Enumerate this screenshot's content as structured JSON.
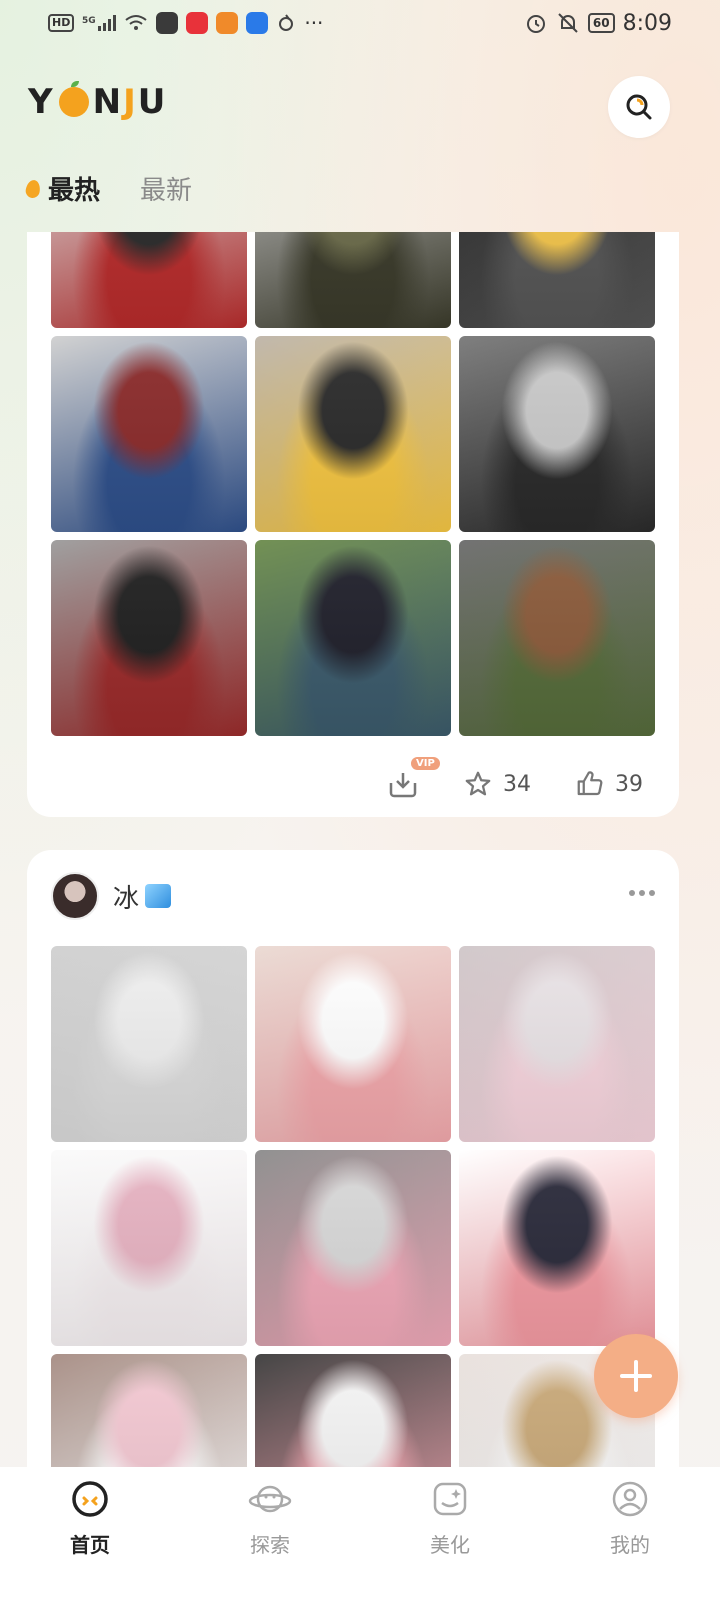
{
  "status_bar": {
    "left_badges": [
      "HD",
      "5G"
    ],
    "time": "8:09",
    "battery": "60",
    "icons": [
      "signal-icon",
      "wifi-icon",
      "app-tile-icons",
      "more-dots-icon",
      "alarm-icon",
      "mute-icon",
      "battery-icon"
    ]
  },
  "header": {
    "logo": {
      "y": "Y",
      "o": "",
      "n": "N",
      "j": "J",
      "u": "U"
    },
    "search_icon": "search-icon"
  },
  "tabs": [
    {
      "label": "最热",
      "active": true
    },
    {
      "label": "最新",
      "active": false
    }
  ],
  "card_1": {
    "photos": [
      {
        "name": "photo-red-scarf-woman",
        "colors": [
          "#b62b2b",
          "#2a2a2a",
          "#dadada"
        ]
      },
      {
        "name": "photo-backpack-long-hair",
        "colors": [
          "#3a3a2a",
          "#6b6b4a",
          "#bbb"
        ]
      },
      {
        "name": "photo-street-knee-socks",
        "colors": [
          "#555",
          "#f2c44b",
          "#222"
        ]
      },
      {
        "name": "photo-plaid-scarf-snow",
        "colors": [
          "#2e4f8a",
          "#8a2a2a",
          "#cfcfcf"
        ]
      },
      {
        "name": "photo-maple-leaf-girl",
        "colors": [
          "#f4c542",
          "#2a2a2a",
          "#bdb4a8"
        ]
      },
      {
        "name": "photo-hood-snow",
        "colors": [
          "#2a2a2a",
          "#c9c9c9",
          "#777"
        ]
      },
      {
        "name": "photo-peace-sign-selfie",
        "colors": [
          "#9a2a2a",
          "#1f1f1f",
          "#9a9a9a"
        ]
      },
      {
        "name": "photo-school-uniform-lake",
        "colors": [
          "#3b5a6b",
          "#1f1f2a",
          "#6a8a4a"
        ]
      },
      {
        "name": "photo-green-jacket-crouch",
        "colors": [
          "#556b3a",
          "#8a5a3a",
          "#6a6a6a"
        ]
      }
    ],
    "download_vip_label": "VIP",
    "star_count": "34",
    "like_count": "39"
  },
  "card_2": {
    "author": {
      "name": "冰",
      "emoji_icon": "ice-cube-icon"
    },
    "photos": [
      {
        "name": "photo-bubbles",
        "colors": [
          "#dcdcdc",
          "#efefef",
          "#cfcfcf"
        ]
      },
      {
        "name": "photo-pink-rose-bouquet-1",
        "colors": [
          "#f1a7ab",
          "#ffffff",
          "#ead9d2"
        ]
      },
      {
        "name": "photo-pink-plush-toy",
        "colors": [
          "#f6d4dd",
          "#e9e3e6",
          "#cfc6c8"
        ]
      },
      {
        "name": "photo-white-puppy-roses",
        "colors": [
          "#f4eef0",
          "#e7b3c2",
          "#fafafa"
        ]
      },
      {
        "name": "photo-balloon-rose-bouquet",
        "colors": [
          "#f0a8b8",
          "#d8d8d8",
          "#8a8a8a"
        ]
      },
      {
        "name": "photo-rose-bouquet-night",
        "colors": [
          "#f29aa2",
          "#2a2a3a",
          "#ffffff"
        ]
      },
      {
        "name": "photo-white-bouquet-bag",
        "colors": [
          "#ffffff",
          "#f3c8d2",
          "#a58b82"
        ]
      },
      {
        "name": "photo-pink-rose-bouquet-2",
        "colors": [
          "#f0a6b0",
          "#f4f4f4",
          "#3a3a3a"
        ]
      },
      {
        "name": "photo-ros-gift-box",
        "colors": [
          "#fafafa",
          "#c9a979",
          "#e8e0dc"
        ]
      }
    ]
  },
  "fab": {
    "icon": "plus-icon"
  },
  "bottom_nav": [
    {
      "label": "首页",
      "icon": "home-face-icon",
      "active": true
    },
    {
      "label": "探索",
      "icon": "planet-icon",
      "active": false
    },
    {
      "label": "美化",
      "icon": "sticker-icon",
      "active": false
    },
    {
      "label": "我的",
      "icon": "profile-icon",
      "active": false
    }
  ],
  "colors": {
    "accent_orange": "#f4a21e",
    "fab_peach": "#f4ae86",
    "vip_badge": "#f0a07c"
  }
}
